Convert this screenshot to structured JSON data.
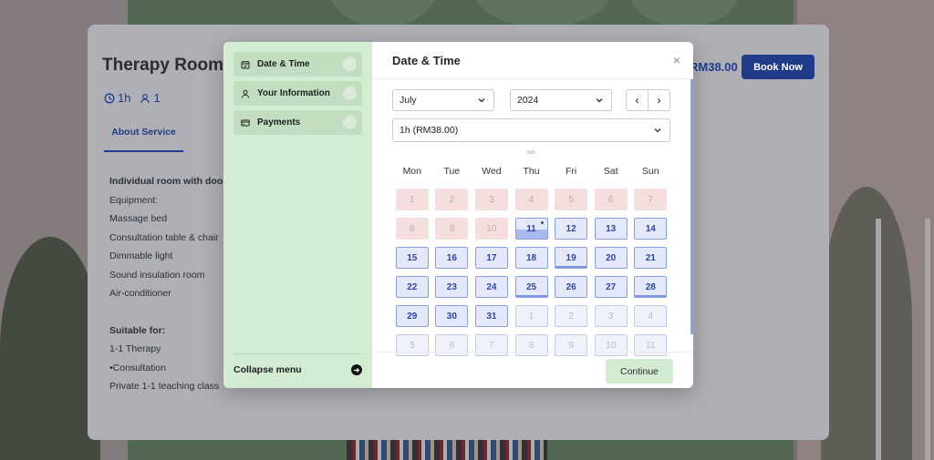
{
  "service": {
    "title": "Therapy Room B",
    "duration": "1h",
    "capacity": "1",
    "tab": "About Service",
    "price": "RM38.00",
    "book_now": "Book Now",
    "details": [
      {
        "text": "Individual room with door",
        "bold": true
      },
      {
        "text": "Equipment:"
      },
      {
        "text": "Massage bed"
      },
      {
        "text": "Consultation table & chair"
      },
      {
        "text": "Dimmable light"
      },
      {
        "text": "Sound insulation room"
      },
      {
        "text": "Air-conditioner"
      },
      {
        "text": "",
        "gap": true
      },
      {
        "text": "Suitable for:",
        "bold": true
      },
      {
        "text": "1-1 Therapy"
      },
      {
        "text": "•Consultation"
      },
      {
        "text": "Private 1-1 teaching class"
      }
    ]
  },
  "sidebar": {
    "steps": [
      {
        "label": "Date & Time",
        "icon": "calendar-icon"
      },
      {
        "label": "Your Information",
        "icon": "user-icon"
      },
      {
        "label": "Payments",
        "icon": "card-icon"
      }
    ],
    "collapse": "Collapse menu"
  },
  "modal": {
    "title": "Date & Time",
    "month": "July",
    "year": "2024",
    "duration_option": "1h  (RM38.00)",
    "continue": "Continue",
    "close_icon": "×",
    "prev_icon": "‹",
    "next_icon": "›"
  },
  "calendar": {
    "weekdays": [
      "Mon",
      "Tue",
      "Wed",
      "Thu",
      "Fri",
      "Sat",
      "Sun"
    ],
    "weeks": [
      [
        {
          "d": "1",
          "s": "past"
        },
        {
          "d": "2",
          "s": "past"
        },
        {
          "d": "3",
          "s": "past"
        },
        {
          "d": "4",
          "s": "past"
        },
        {
          "d": "5",
          "s": "past"
        },
        {
          "d": "6",
          "s": "past"
        },
        {
          "d": "7",
          "s": "past"
        }
      ],
      [
        {
          "d": "8",
          "s": "past"
        },
        {
          "d": "9",
          "s": "past"
        },
        {
          "d": "10",
          "s": "past"
        },
        {
          "d": "11",
          "s": "avail",
          "today": true,
          "selected": true
        },
        {
          "d": "12",
          "s": "avail"
        },
        {
          "d": "13",
          "s": "avail"
        },
        {
          "d": "14",
          "s": "avail"
        }
      ],
      [
        {
          "d": "15",
          "s": "avail"
        },
        {
          "d": "16",
          "s": "avail"
        },
        {
          "d": "17",
          "s": "avail"
        },
        {
          "d": "18",
          "s": "avail"
        },
        {
          "d": "19",
          "s": "avail",
          "mark": true
        },
        {
          "d": "20",
          "s": "avail"
        },
        {
          "d": "21",
          "s": "avail"
        }
      ],
      [
        {
          "d": "22",
          "s": "avail"
        },
        {
          "d": "23",
          "s": "avail"
        },
        {
          "d": "24",
          "s": "avail"
        },
        {
          "d": "25",
          "s": "avail",
          "mark": true
        },
        {
          "d": "26",
          "s": "avail"
        },
        {
          "d": "27",
          "s": "avail"
        },
        {
          "d": "28",
          "s": "avail",
          "mark": true
        }
      ],
      [
        {
          "d": "29",
          "s": "avail"
        },
        {
          "d": "30",
          "s": "avail"
        },
        {
          "d": "31",
          "s": "avail"
        },
        {
          "d": "1",
          "s": "other"
        },
        {
          "d": "2",
          "s": "other"
        },
        {
          "d": "3",
          "s": "other"
        },
        {
          "d": "4",
          "s": "other"
        }
      ],
      [
        {
          "d": "5",
          "s": "other"
        },
        {
          "d": "6",
          "s": "other"
        },
        {
          "d": "7",
          "s": "other"
        },
        {
          "d": "8",
          "s": "other"
        },
        {
          "d": "9",
          "s": "other"
        },
        {
          "d": "10",
          "s": "other"
        },
        {
          "d": "11",
          "s": "other"
        }
      ]
    ]
  },
  "colors": {
    "primary": "#1f3b8a",
    "sidebar_bg": "#d3ecd1",
    "past_day": "#f4dede",
    "available_day": "#e3e9fb"
  }
}
